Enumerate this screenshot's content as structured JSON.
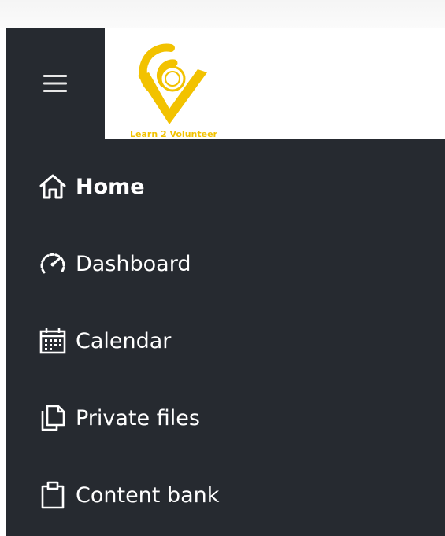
{
  "header": {
    "menu_toggle": "hamburger-icon",
    "logo": {
      "tagline": "Learn 2 Volunteer",
      "brand_color": "#f2c200"
    }
  },
  "nav": {
    "background": "#262a30",
    "items": [
      {
        "label": "Home",
        "icon": "home-icon",
        "active": true
      },
      {
        "label": "Dashboard",
        "icon": "dashboard-icon",
        "active": false
      },
      {
        "label": "Calendar",
        "icon": "calendar-icon",
        "active": false
      },
      {
        "label": "Private files",
        "icon": "files-icon",
        "active": false
      },
      {
        "label": "Content bank",
        "icon": "clipboard-icon",
        "active": false
      }
    ]
  }
}
